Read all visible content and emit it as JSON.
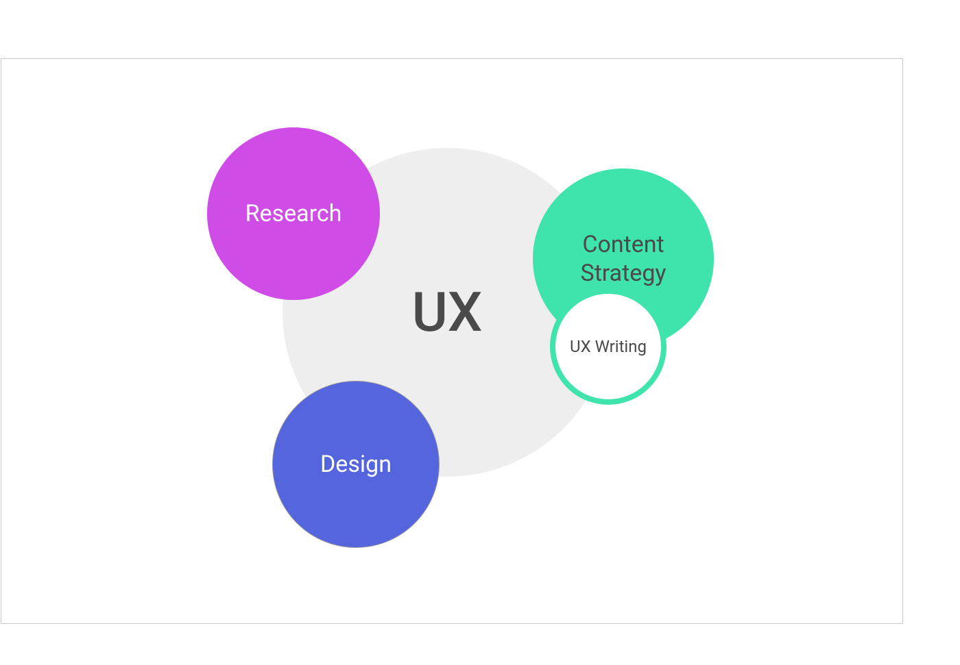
{
  "diagram": {
    "center": {
      "label": "UX",
      "color": "#eeeeee",
      "text_color": "#4a4a4a"
    },
    "nodes": {
      "research": {
        "label": "Research",
        "color": "#cf4ce6",
        "text_color": "#ffffff"
      },
      "content_strategy": {
        "label": "Content\nStrategy",
        "color": "#3fe3ac",
        "text_color": "#4a4a4a"
      },
      "ux_writing": {
        "label": "UX Writing",
        "color": "#ffffff",
        "border_color": "#3fe3ac",
        "text_color": "#4a4a4a"
      },
      "design": {
        "label": "Design",
        "color": "#5565dd",
        "text_color": "#ffffff"
      }
    }
  }
}
